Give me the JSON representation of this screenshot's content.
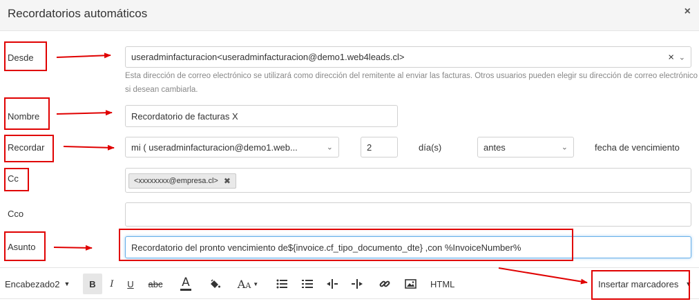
{
  "modal": {
    "title": "Recordatorios automáticos",
    "close_glyph": "×"
  },
  "form": {
    "desde": {
      "label": "Desde",
      "value": "useradminfacturacion<useradminfacturacion@demo1.web4leads.cl>",
      "clear_glyph": "×",
      "help": "Esta dirección de correo electrónico se utilizará como dirección del remitente al enviar las facturas. Otros usuarios pueden elegir su dirección de correo electrónico si desean cambiarla."
    },
    "nombre": {
      "label": "Nombre",
      "value": "Recordatorio de facturas X"
    },
    "recordar": {
      "label": "Recordar",
      "recipient": "mi ( useradminfacturacion@demo1.web...",
      "days": "2",
      "unit": "día(s)",
      "when": "antes",
      "reference": "fecha de vencimiento"
    },
    "cc": {
      "label": "Cc",
      "tags": [
        "<xxxxxxxx@empresa.cl>"
      ],
      "tag_remove_glyph": "✖"
    },
    "cco": {
      "label": "Cco",
      "value": ""
    },
    "asunto": {
      "label": "Asunto",
      "value": "Recordatorio del pronto vencimiento de${invoice.cf_tipo_documento_dte} ,con %InvoiceNumber%"
    }
  },
  "toolbar": {
    "heading": "Encabezado2",
    "bold": "B",
    "italic": "I",
    "underline": "U",
    "strike": "abc",
    "font_color": "A",
    "font_size": "A",
    "html": "HTML",
    "insert_placeholders": "Insertar marcadores"
  },
  "colors": {
    "annotation": "#e00000",
    "header_bg": "#f5f5f5",
    "border": "#d0d0d0"
  }
}
